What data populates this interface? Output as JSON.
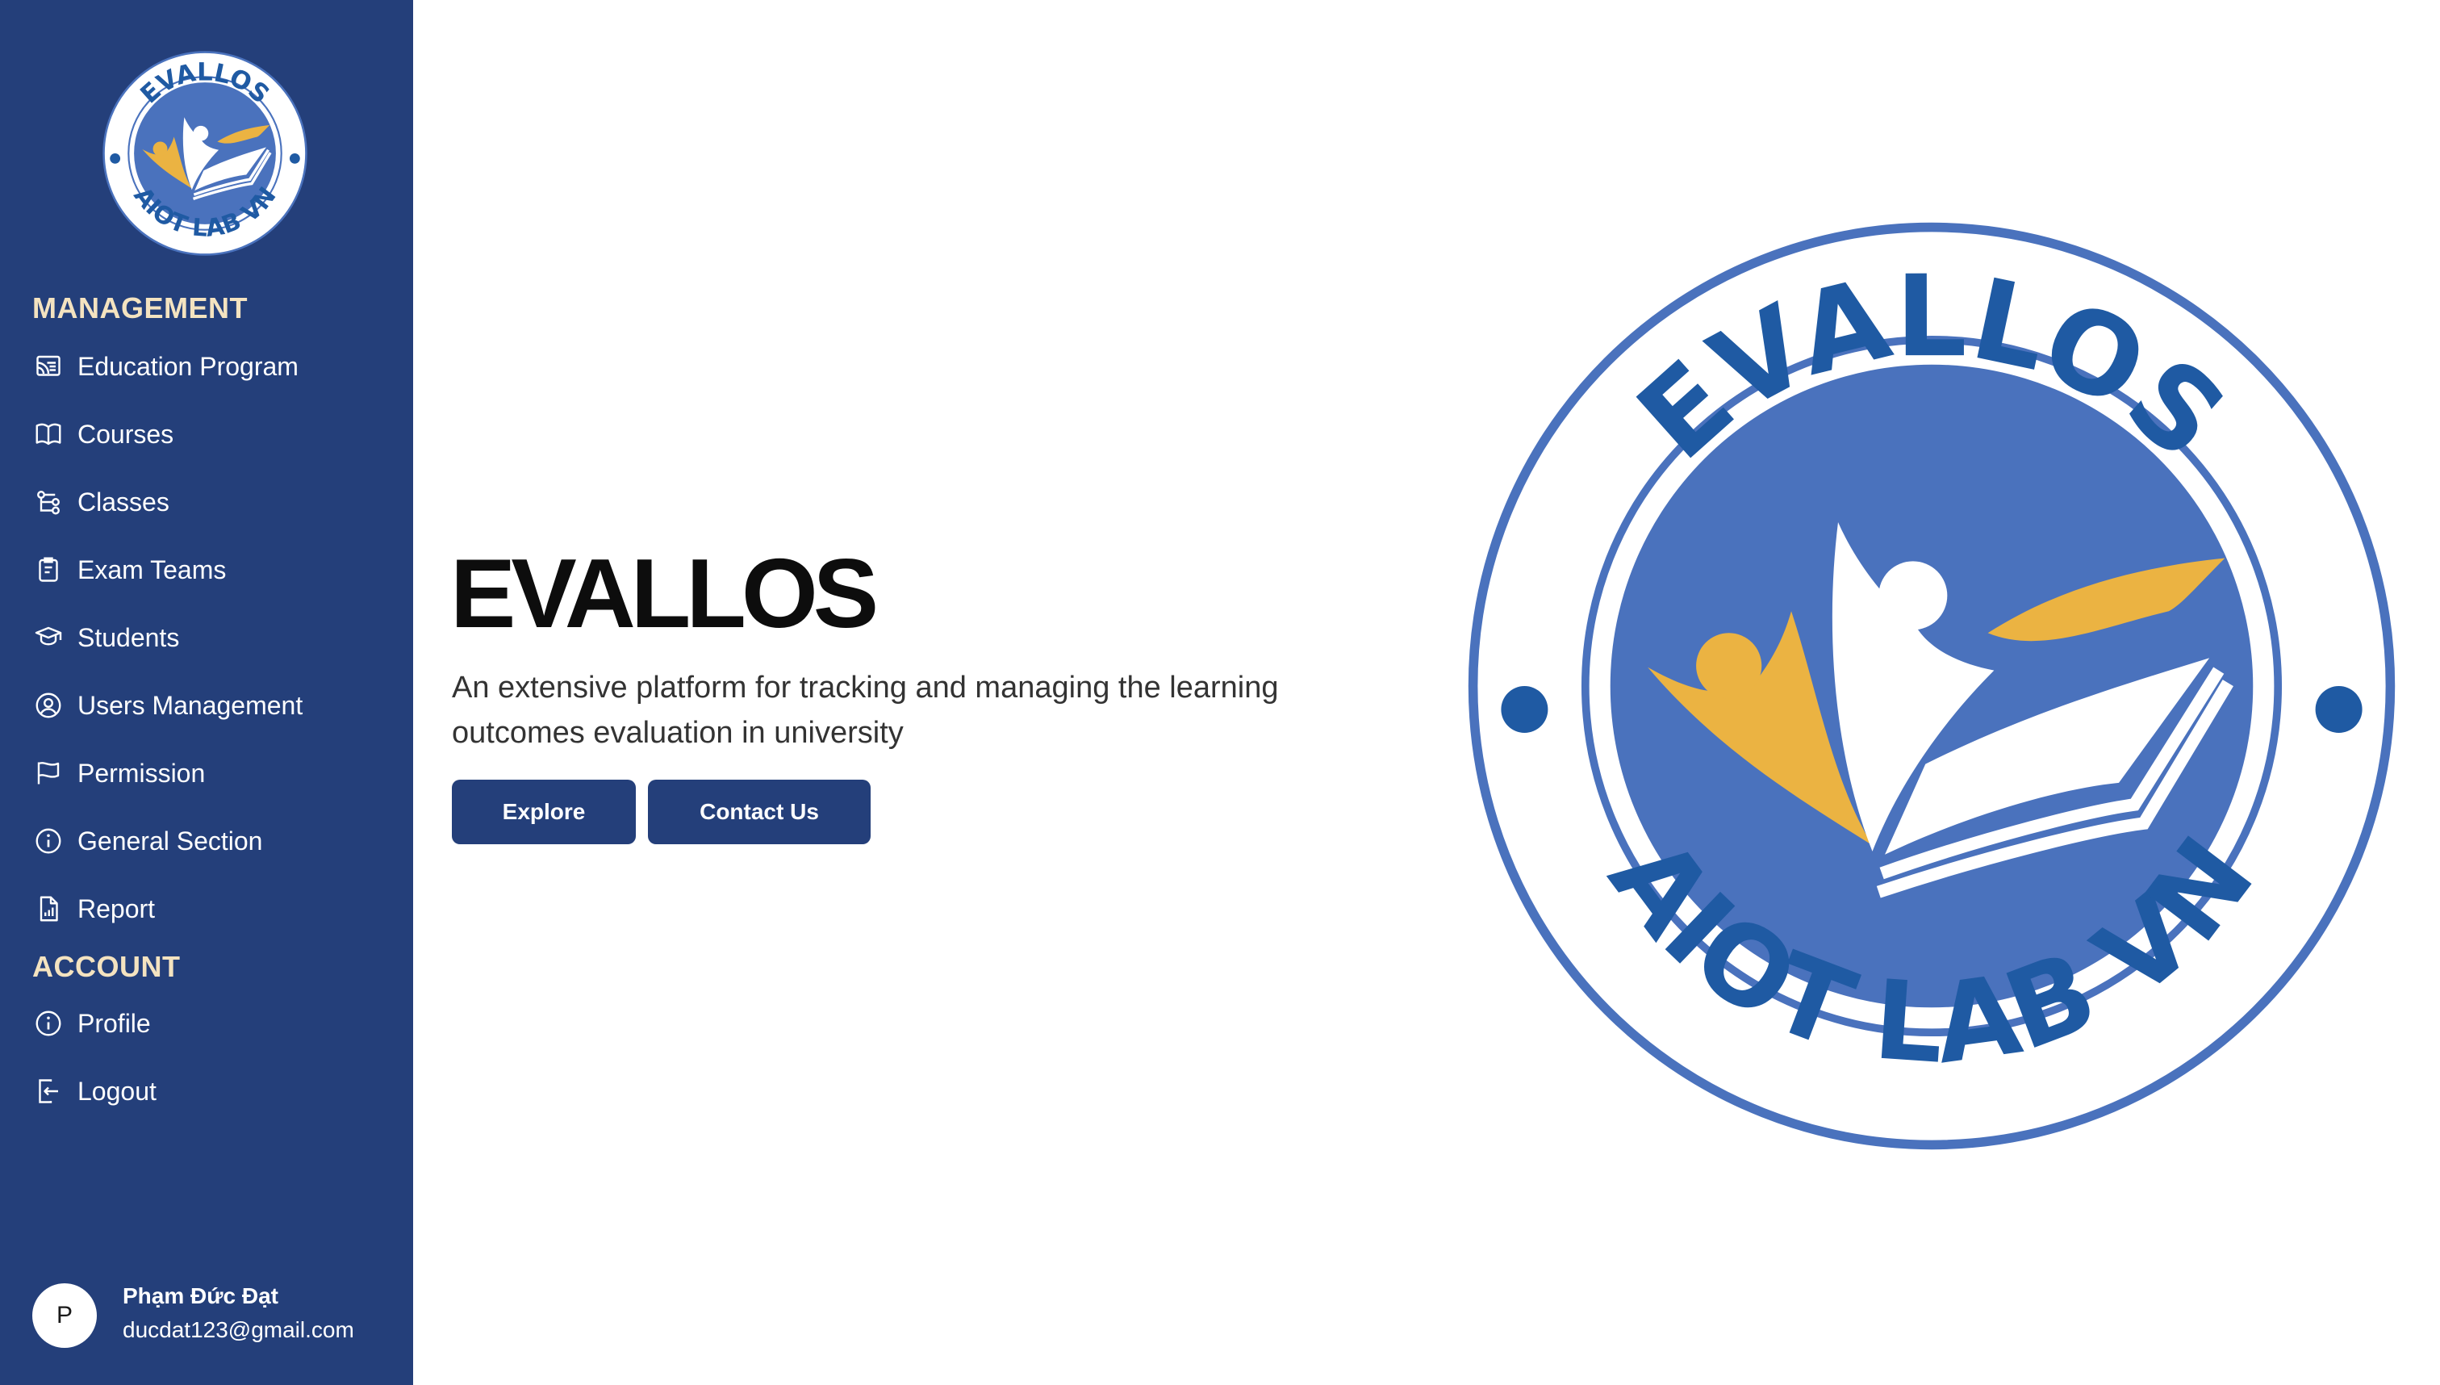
{
  "brand": {
    "logo_top_text": "EVALLOS",
    "logo_bottom_text": "AIOT LAB VN"
  },
  "colors": {
    "sidebar_bg": "#243f7a",
    "section_title": "#f4e3c0",
    "button_bg": "#243f7a",
    "logo_blue": "#4a72bd",
    "logo_text": "#1f5aa3",
    "logo_accent": "#ebb342"
  },
  "sidebar": {
    "sections": [
      {
        "title": "MANAGEMENT",
        "items": [
          {
            "label": "Education Program",
            "icon": "cast-icon"
          },
          {
            "label": "Courses",
            "icon": "book-icon"
          },
          {
            "label": "Classes",
            "icon": "hierarchy-icon"
          },
          {
            "label": "Exam Teams",
            "icon": "clipboard-icon"
          },
          {
            "label": "Students",
            "icon": "graduation-cap-icon"
          },
          {
            "label": "Users Management",
            "icon": "user-circle-icon"
          },
          {
            "label": "Permission",
            "icon": "flag-icon"
          },
          {
            "label": "General Section",
            "icon": "info-icon"
          },
          {
            "label": "Report",
            "icon": "report-icon"
          }
        ]
      },
      {
        "title": "ACCOUNT",
        "items": [
          {
            "label": "Profile",
            "icon": "info-icon"
          },
          {
            "label": "Logout",
            "icon": "logout-icon"
          }
        ]
      }
    ]
  },
  "user": {
    "initial": "P",
    "name": "Phạm Đức Đạt",
    "email": "ducdat123@gmail.com"
  },
  "hero": {
    "title": "EVALLOS",
    "subtitle": "An extensive platform for tracking and managing the learning outcomes evaluation in university",
    "buttons": {
      "explore": "Explore",
      "contact": "Contact Us"
    }
  }
}
